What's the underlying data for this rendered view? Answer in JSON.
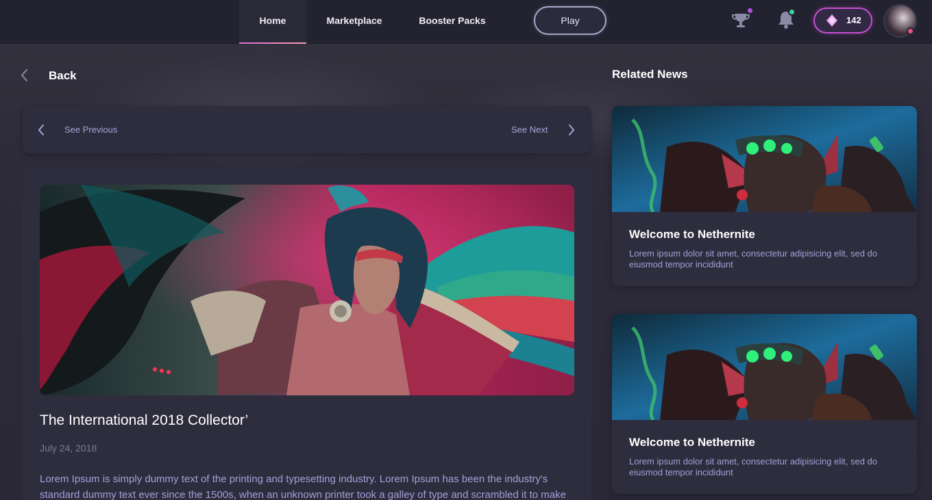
{
  "nav": {
    "links": [
      {
        "label": "Home",
        "active": true
      },
      {
        "label": "Marketplace",
        "active": false
      },
      {
        "label": "Booster Packs",
        "active": false
      }
    ],
    "play_label": "Play",
    "trophy_icon": "trophy-icon",
    "bell_icon": "bell-icon",
    "gem_icon": "gem-icon",
    "gem_count": "142",
    "colors": {
      "accent": "#c84fd0",
      "trophy_dot": "#b34fe0",
      "bell_dot": "#3fd2a0",
      "avatar_dot": "#e2557a"
    }
  },
  "back": {
    "label": "Back",
    "icon": "chevron-left-icon"
  },
  "pager": {
    "previous_label": "See Previous",
    "next_label": "See Next"
  },
  "article": {
    "title": "The International 2018 Collector’",
    "date": "July 24, 2018",
    "body": "Lorem Ipsum is simply dummy text of the printing and typesetting industry. Lorem Ipsum has been the industry's standard dummy text ever since the 1500s, when an unknown printer took a galley of type and scrambled it to make a type specimen book."
  },
  "related": {
    "title": "Related News",
    "items": [
      {
        "title": "Welcome to Nethernite",
        "description": "Lorem ipsum dolor sit amet, consectetur adipisicing elit, sed do eiusmod tempor incididunt"
      },
      {
        "title": "Welcome to Nethernite",
        "description": "Lorem ipsum dolor sit amet, consectetur adipisicing elit, sed do eiusmod tempor incididunt"
      }
    ]
  }
}
